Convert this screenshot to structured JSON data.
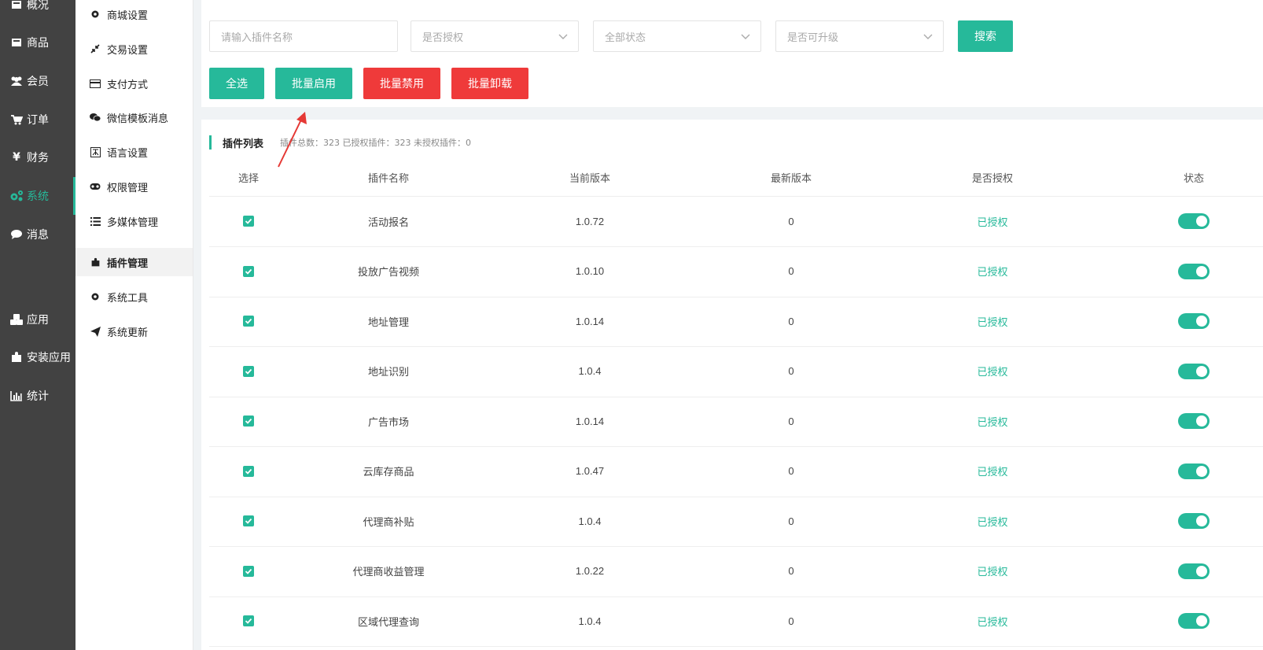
{
  "nav": {
    "primary": [
      {
        "label": "概况",
        "icon": "dashboard-icon"
      },
      {
        "label": "商品",
        "icon": "product-icon"
      },
      {
        "label": "会员",
        "icon": "users-icon"
      },
      {
        "label": "订单",
        "icon": "cart-icon"
      },
      {
        "label": "财务",
        "icon": "yen-icon"
      },
      {
        "label": "系统",
        "icon": "gears-icon",
        "active": true
      },
      {
        "label": "消息",
        "icon": "comment-icon"
      },
      {
        "label": "应用",
        "icon": "cubes-icon"
      },
      {
        "label": "安装应用",
        "icon": "puzzle-icon"
      },
      {
        "label": "统计",
        "icon": "bar-chart-icon"
      }
    ],
    "secondary": [
      {
        "label": "商城设置",
        "icon": "gear-icon"
      },
      {
        "label": "交易设置",
        "icon": "compress-icon"
      },
      {
        "label": "支付方式",
        "icon": "credit-card-icon"
      },
      {
        "label": "微信模板消息",
        "icon": "wechat-icon"
      },
      {
        "label": "语言设置",
        "icon": "language-icon"
      },
      {
        "label": "权限管理",
        "icon": "key-icon"
      },
      {
        "label": "多媒体管理",
        "icon": "list-icon"
      },
      {
        "label": "插件管理",
        "icon": "puzzle-icon",
        "active": true
      },
      {
        "label": "系统工具",
        "icon": "tools-icon"
      },
      {
        "label": "系统更新",
        "icon": "send-icon"
      }
    ]
  },
  "filters": {
    "name_placeholder": "请输入插件名称",
    "authorized_select": "是否授权",
    "status_select": "全部状态",
    "upgradable_select": "是否可升级",
    "search_label": "搜索"
  },
  "actions": {
    "select_all": "全选",
    "batch_enable": "批量启用",
    "batch_disable": "批量禁用",
    "batch_uninstall": "批量卸载"
  },
  "list": {
    "title": "插件列表",
    "stats": "插件总数：323 已授权插件：323 未授权插件：0",
    "columns": {
      "select": "选择",
      "name": "插件名称",
      "current_version": "当前版本",
      "latest_version": "最新版本",
      "authorized": "是否授权",
      "status": "状态"
    },
    "rows": [
      {
        "name": "活动报名",
        "current": "1.0.72",
        "latest": "0",
        "auth": "已授权"
      },
      {
        "name": "投放广告视频",
        "current": "1.0.10",
        "latest": "0",
        "auth": "已授权"
      },
      {
        "name": "地址管理",
        "current": "1.0.14",
        "latest": "0",
        "auth": "已授权"
      },
      {
        "name": "地址识别",
        "current": "1.0.4",
        "latest": "0",
        "auth": "已授权"
      },
      {
        "name": "广告市场",
        "current": "1.0.14",
        "latest": "0",
        "auth": "已授权"
      },
      {
        "name": "云库存商品",
        "current": "1.0.47",
        "latest": "0",
        "auth": "已授权"
      },
      {
        "name": "代理商补贴",
        "current": "1.0.4",
        "latest": "0",
        "auth": "已授权"
      },
      {
        "name": "代理商收益管理",
        "current": "1.0.22",
        "latest": "0",
        "auth": "已授权"
      },
      {
        "name": "区域代理查询",
        "current": "1.0.4",
        "latest": "0",
        "auth": "已授权"
      }
    ]
  },
  "colors": {
    "accent": "#26b99a",
    "danger": "#ef3a3a",
    "sidebar": "#424242"
  }
}
